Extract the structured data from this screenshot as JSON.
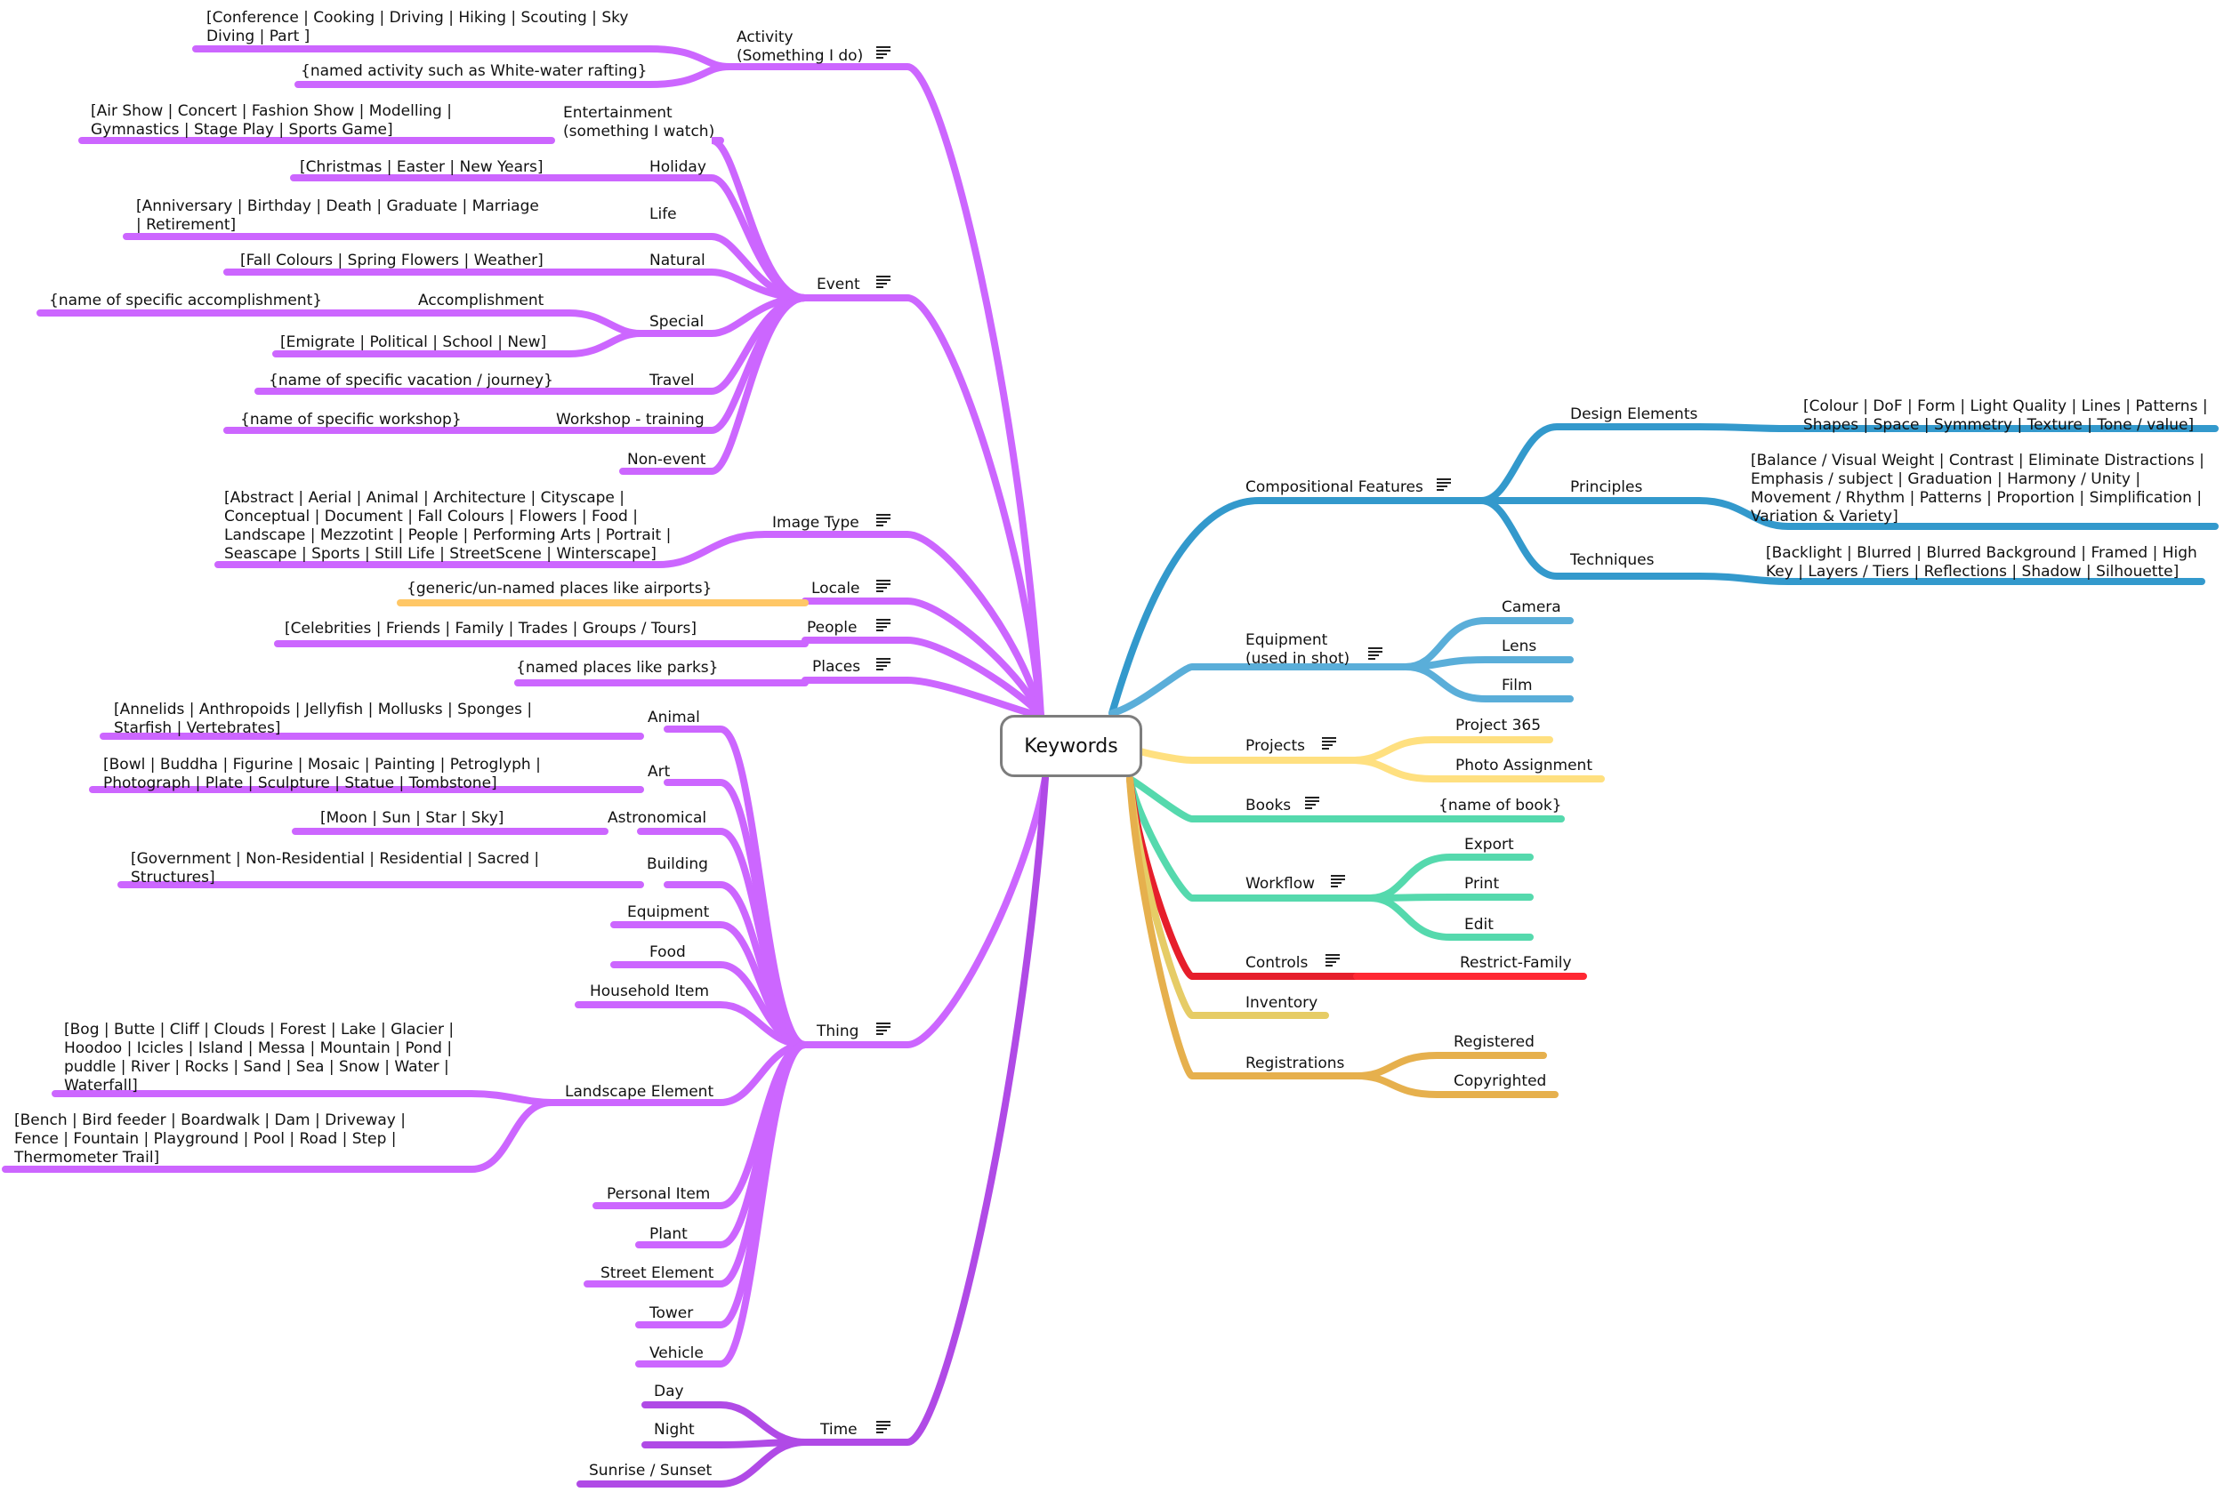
{
  "root": {
    "label": "Keywords"
  },
  "colors": {
    "purple": "#cc66ff",
    "purple_dark": "#b04ae6",
    "locale_leaf": "#ffc766",
    "blue_dark": "#3399cc",
    "blue_light": "#5aaed9",
    "yellow": "#ffe080",
    "green": "#55d9ad",
    "red": "#e61e2b",
    "gold": "#e6cc66",
    "orange": "#e6b04d",
    "node_border": "#7d7d7d"
  },
  "left": [
    {
      "label": "Activity\n(Something I do)",
      "note": true,
      "children": [
        {
          "label": "[Conference | Cooking | Driving | Hiking | Scouting | Sky Diving | Part ]"
        },
        {
          "label": "{named activity such as White-water rafting}"
        }
      ]
    },
    {
      "label": "Event",
      "note": true,
      "children": [
        {
          "label": "Entertainment\n(something I watch)",
          "children": [
            {
              "label": "[Air Show | Concert | Fashion Show | Modelling | Gymnastics | Stage Play | Sports Game]"
            }
          ]
        },
        {
          "label": "Holiday",
          "children": [
            {
              "label": "[Christmas | Easter | New Years]"
            }
          ]
        },
        {
          "label": "Life",
          "children": [
            {
              "label": "[Anniversary | Birthday | Death | Graduate | Marriage | Retirement]"
            }
          ]
        },
        {
          "label": "Natural",
          "children": [
            {
              "label": "[Fall Colours | Spring Flowers | Weather]"
            }
          ]
        },
        {
          "label": "Special",
          "children": [
            {
              "label": "Accomplishment",
              "children": [
                {
                  "label": "{name of specific accomplishment}"
                }
              ]
            },
            {
              "label": "[Emigrate | Political | School | New]"
            }
          ]
        },
        {
          "label": "Travel",
          "children": [
            {
              "label": "{name of specific vacation / journey}"
            }
          ]
        },
        {
          "label": "Workshop - training",
          "children": [
            {
              "label": "{name of specific workshop}"
            }
          ]
        },
        {
          "label": "Non-event"
        }
      ]
    },
    {
      "label": "Image Type",
      "note": true,
      "children": [
        {
          "label": "[Abstract | Aerial | Animal | Architecture | Cityscape | Conceptual | Document | Fall Colours | Flowers | Food | Landscape | Mezzotint | People | Performing Arts | Portrait | Seascape | Sports | Still Life | StreetScene | Winterscape]"
        }
      ]
    },
    {
      "label": "Locale",
      "note": true,
      "children": [
        {
          "label": "{generic/un-named places like airports}"
        }
      ]
    },
    {
      "label": "People",
      "note": true,
      "children": [
        {
          "label": "[Celebrities | Friends | Family | Trades | Groups / Tours]"
        }
      ]
    },
    {
      "label": "Places",
      "note": true,
      "children": [
        {
          "label": "{named places like parks}"
        }
      ]
    },
    {
      "label": "Thing",
      "note": true,
      "children": [
        {
          "label": "Animal",
          "children": [
            {
              "label": "[Annelids | Anthropoids |  Jellyfish | Mollusks | Sponges | Starfish | Vertebrates]"
            }
          ]
        },
        {
          "label": "Art",
          "children": [
            {
              "label": "[Bowl | Buddha | Figurine | Mosaic | Painting | Petroglyph | Photograph | Plate | Sculpture | Statue | Tombstone]"
            }
          ]
        },
        {
          "label": "Astronomical",
          "children": [
            {
              "label": "[Moon | Sun | Star | Sky]"
            }
          ]
        },
        {
          "label": "Building",
          "children": [
            {
              "label": "[Government | Non-Residential | Residential | Sacred | Structures]"
            }
          ]
        },
        {
          "label": "Equipment"
        },
        {
          "label": "Food"
        },
        {
          "label": "Household Item"
        },
        {
          "label": "Landscape Element",
          "children": [
            {
              "label": "[Bog | Butte | Cliff | Clouds | Forest | Lake | Glacier | Hoodoo | Icicles | Island | Messa | Mountain | Pond | puddle | River | Rocks | Sand | Sea | Snow | Water | Waterfall]"
            },
            {
              "label": "[Bench | Bird feeder | Boardwalk | Dam | Driveway | Fence | Fountain | Playground | Pool | Road | Step | Thermometer Trail]"
            }
          ]
        },
        {
          "label": "Personal Item"
        },
        {
          "label": "Plant"
        },
        {
          "label": "Street Element"
        },
        {
          "label": "Tower"
        },
        {
          "label": "Vehicle"
        }
      ]
    },
    {
      "label": "Time",
      "note": true,
      "children": [
        {
          "label": "Day"
        },
        {
          "label": "Night"
        },
        {
          "label": "Sunrise / Sunset"
        }
      ]
    }
  ],
  "right": [
    {
      "label": "Compositional Features",
      "note": true,
      "children": [
        {
          "label": "Design Elements",
          "children": [
            {
              "label": "[Colour | DoF | Form | Light Quality | Lines | Patterns | Shapes | Space | Symmetry | Texture | Tone / value]"
            }
          ]
        },
        {
          "label": "Principles",
          "children": [
            {
              "label": "[Balance / Visual Weight | Contrast | Eliminate Distractions | Emphasis / subject | Graduation | Harmony / Unity | Movement / Rhythm | Patterns | Proportion | Simplification | Variation & Variety]"
            }
          ]
        },
        {
          "label": "Techniques",
          "children": [
            {
              "label": "[Backlight | Blurred | Blurred Background | Framed | High Key | Layers / Tiers | Reflections | Shadow | Silhouette]"
            }
          ]
        }
      ]
    },
    {
      "label": "Equipment\n(used in shot)",
      "note": true,
      "children": [
        {
          "label": "Camera"
        },
        {
          "label": "Lens"
        },
        {
          "label": "Film"
        }
      ]
    },
    {
      "label": "Projects",
      "note": true,
      "children": [
        {
          "label": "Project 365"
        },
        {
          "label": "Photo Assignment"
        }
      ]
    },
    {
      "label": "Books",
      "note": true,
      "children": [
        {
          "label": "{name of book}"
        }
      ]
    },
    {
      "label": "Workflow",
      "note": true,
      "children": [
        {
          "label": "Export"
        },
        {
          "label": "Print"
        },
        {
          "label": "Edit"
        }
      ]
    },
    {
      "label": "Controls",
      "note": true,
      "children": [
        {
          "label": "Restrict-Family"
        }
      ]
    },
    {
      "label": "Inventory"
    },
    {
      "label": "Registrations",
      "children": [
        {
          "label": "Registered"
        },
        {
          "label": "Copyrighted"
        }
      ]
    }
  ]
}
